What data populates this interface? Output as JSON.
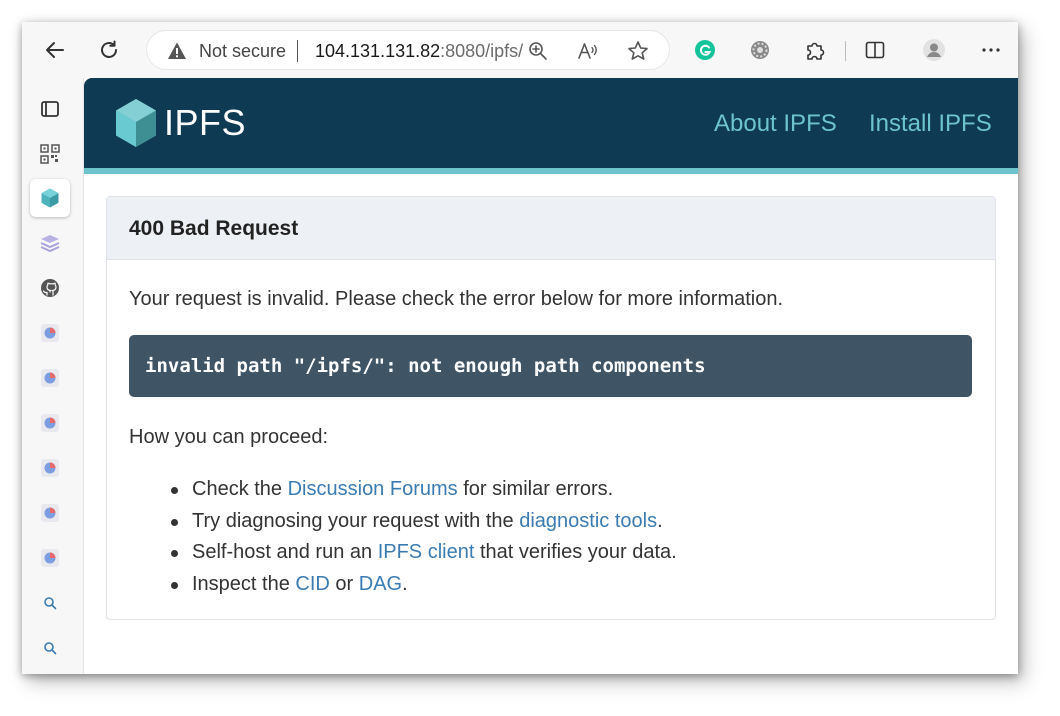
{
  "browser": {
    "not_secure_label": "Not secure",
    "url_host": "104.131.131.82",
    "url_rest": ":8080/ipfs/"
  },
  "page": {
    "logo_text": "IPFS",
    "nav": {
      "about": "About IPFS",
      "install": "Install IPFS"
    },
    "card": {
      "title": "400 Bad Request",
      "intro": "Your request is invalid. Please check the error below for more information.",
      "error": "invalid path \"/ipfs/\": not enough path components",
      "proceed_heading": "How you can proceed:",
      "items": [
        {
          "pre": "Check the ",
          "link": "Discussion Forums",
          "post": " for similar errors."
        },
        {
          "pre": "Try diagnosing your request with the ",
          "link": "diagnostic tools",
          "post": "."
        },
        {
          "pre": "Self-host and run an ",
          "link": "IPFS client",
          "post": " that verifies your data."
        },
        {
          "pre": "Inspect the ",
          "link": "CID",
          "mid": " or ",
          "link2": "DAG",
          "post": "."
        }
      ]
    }
  },
  "colors": {
    "header_bg": "#0f3a53",
    "accent": "#6dc4cd",
    "error_bg": "#3f5465",
    "link": "#3b7bb3"
  }
}
